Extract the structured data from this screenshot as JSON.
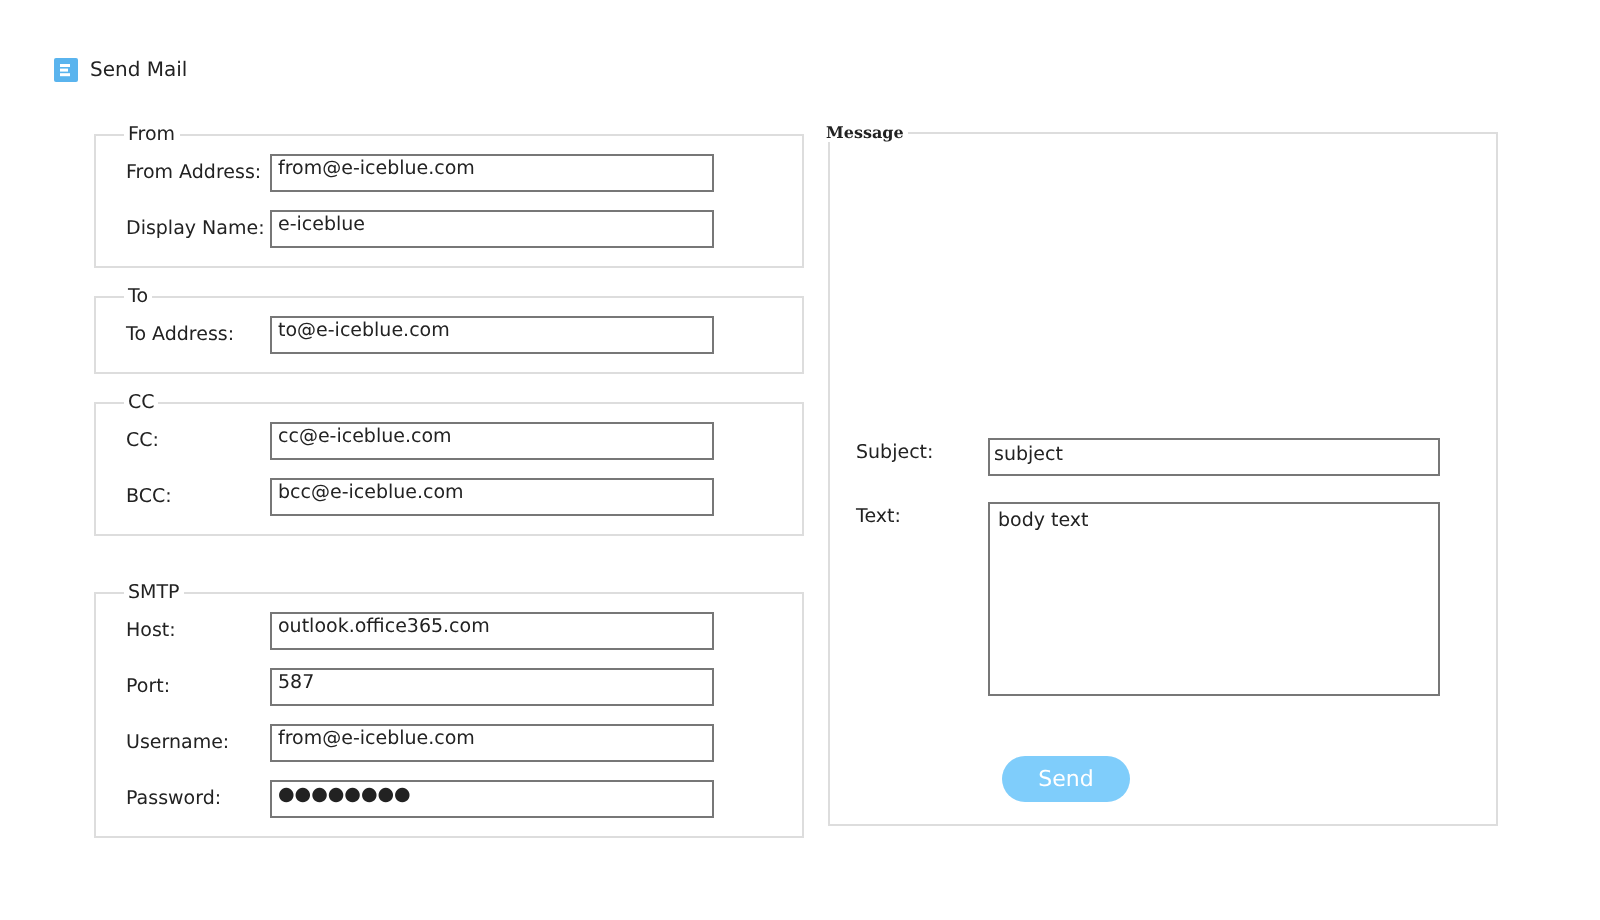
{
  "window": {
    "title": "Send Mail"
  },
  "groups": [
    {
      "legend": "From",
      "fields": [
        {
          "label": "From Address:",
          "value": "from@e-iceblue.com"
        },
        {
          "label": "Display Name:",
          "value": "e-iceblue"
        }
      ]
    },
    {
      "legend": "To",
      "fields": [
        {
          "label": "To Address:",
          "value": "to@e-iceblue.com"
        }
      ]
    },
    {
      "legend": "CC",
      "fields": [
        {
          "label": "CC:",
          "value": "cc@e-iceblue.com"
        },
        {
          "label": "BCC:",
          "value": "bcc@e-iceblue.com"
        }
      ]
    },
    {
      "legend": "SMTP",
      "fields": [
        {
          "label": "Host:",
          "value": "outlook.office365.com"
        },
        {
          "label": "Port:",
          "value": "587"
        },
        {
          "label": "Username:",
          "value": "from@e-iceblue.com"
        },
        {
          "label": "Password:",
          "value": "●●●●●●●●"
        }
      ]
    }
  ],
  "message": {
    "legend": "Message",
    "subject": {
      "label": "Subject:",
      "value": "subject"
    },
    "text": {
      "label": "Text:",
      "value": "body text"
    }
  },
  "send_button": "Send"
}
